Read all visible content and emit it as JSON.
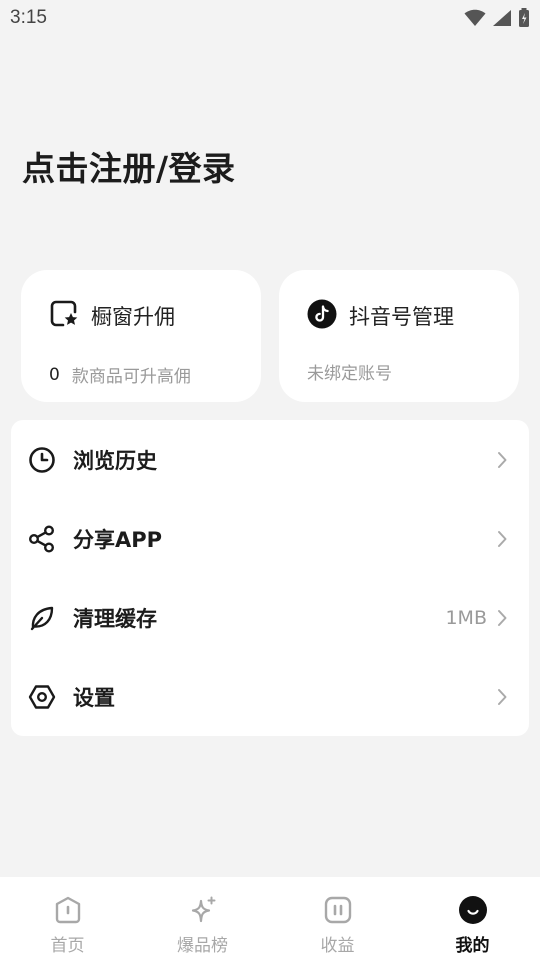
{
  "status_bar": {
    "time": "3:15"
  },
  "login": {
    "title": "点击注册/登录"
  },
  "cards": {
    "showcase": {
      "title": "橱窗升佣",
      "count": "0",
      "subtitle": "款商品可升高佣",
      "icon": "showcase-star-icon"
    },
    "douyin": {
      "title": "抖音号管理",
      "subtitle": "未绑定账号",
      "icon": "tiktok-icon"
    }
  },
  "menu": {
    "items": [
      {
        "label": "浏览历史",
        "value": "",
        "icon": "clock-icon"
      },
      {
        "label": "分享APP",
        "value": "",
        "icon": "share-icon"
      },
      {
        "label": "清理缓存",
        "value": "1MB",
        "icon": "leaf-icon"
      },
      {
        "label": "设置",
        "value": "",
        "icon": "hexagon-settings-icon"
      }
    ]
  },
  "bottom_nav": {
    "items": [
      {
        "label": "首页",
        "icon": "home-icon",
        "active": false
      },
      {
        "label": "爆品榜",
        "icon": "sparkle-icon",
        "active": false
      },
      {
        "label": "收益",
        "icon": "earnings-icon",
        "active": false
      },
      {
        "label": "我的",
        "icon": "profile-icon",
        "active": true
      }
    ]
  },
  "colors": {
    "background": "#f3f3f3",
    "card": "#ffffff",
    "text_primary": "#1c1c1c",
    "text_secondary": "#9a9a9a",
    "nav_inactive": "#a8a8a8",
    "nav_active": "#111111"
  }
}
